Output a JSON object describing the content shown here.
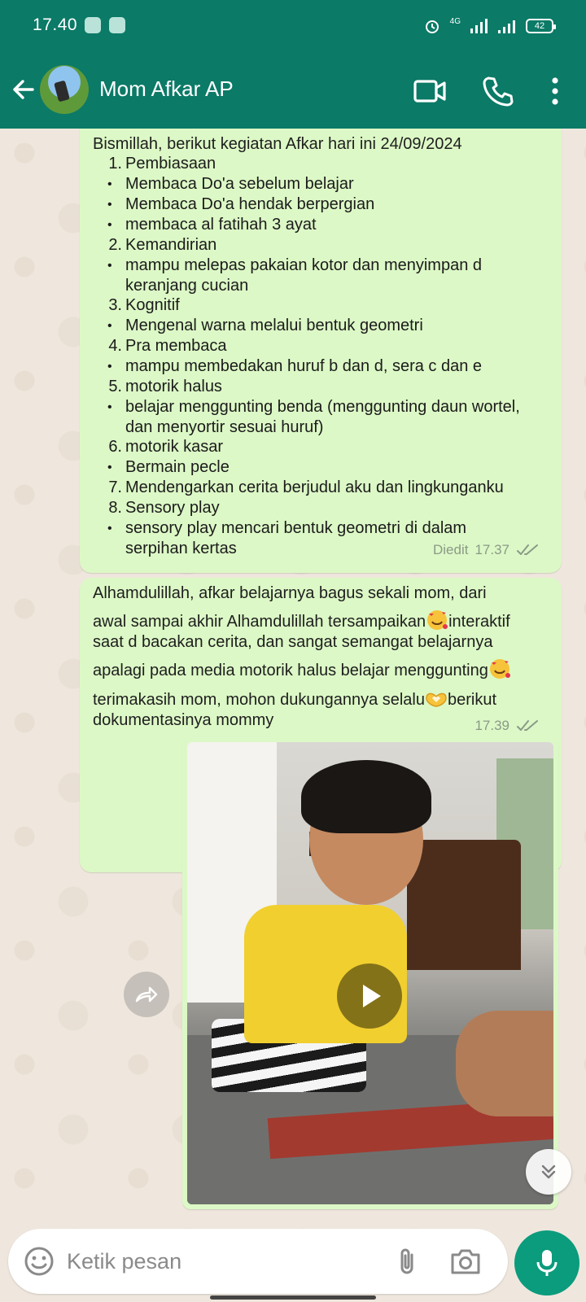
{
  "status_bar": {
    "time": "17.40",
    "network": "4G",
    "battery": "42"
  },
  "header": {
    "contact_name": "Mom Afkar AP"
  },
  "messages": [
    {
      "lines": [
        {
          "kind": "text",
          "text": "Bismillah, berikut kegiatan Afkar hari ini 24/09/2024"
        },
        {
          "kind": "num",
          "num": "1.",
          "text": "Pembiasaan"
        },
        {
          "kind": "bullet",
          "text": "Membaca Do'a sebelum belajar"
        },
        {
          "kind": "bullet",
          "text": "Membaca Do'a hendak berpergian"
        },
        {
          "kind": "bullet",
          "text": "membaca al fatihah 3 ayat"
        },
        {
          "kind": "num",
          "num": "2.",
          "text": "Kemandirian"
        },
        {
          "kind": "bullet",
          "text": "mampu melepas pakaian kotor dan menyimpan d"
        },
        {
          "kind": "cont",
          "text": "keranjang cucian"
        },
        {
          "kind": "num",
          "num": "3.",
          "text": "Kognitif"
        },
        {
          "kind": "bullet",
          "text": "Mengenal warna melalui bentuk geometri"
        },
        {
          "kind": "num",
          "num": "4.",
          "text": "Pra membaca"
        },
        {
          "kind": "bullet",
          "text": "mampu membedakan huruf b dan d, sera c dan e"
        },
        {
          "kind": "num",
          "num": "5.",
          "text": "motorik halus"
        },
        {
          "kind": "bullet",
          "text": "belajar menggunting benda (menggunting daun wortel,"
        },
        {
          "kind": "cont",
          "text": "dan menyortir sesuai huruf)"
        },
        {
          "kind": "num",
          "num": "6.",
          "text": "motorik kasar"
        },
        {
          "kind": "bullet",
          "text": "Bermain pecle"
        },
        {
          "kind": "num",
          "num": "7.",
          "text": "Mendengarkan cerita berjudul aku dan lingkunganku"
        },
        {
          "kind": "num",
          "num": "8.",
          "text": "Sensory play"
        },
        {
          "kind": "bullet",
          "text": "sensory play mencari bentuk geometri di dalam"
        },
        {
          "kind": "cont",
          "text": "serpihan kertas"
        }
      ],
      "edited_label": "Diedit",
      "time": "17.37"
    },
    {
      "lines": [
        "Alhamdulillah, afkar belajarnya bagus sekali mom, dari",
        "awal sampai akhir Alhamdulillah tersampaikan",
        "interaktif",
        "saat d bacakan cerita, dan sangat semangat belajarnya",
        "apalagi pada media motorik halus belajar menggunting",
        "terimakasih mom, mohon dukungannya selalu",
        "berikut",
        "dokumentasinya mommy"
      ],
      "time": "17.39"
    }
  ],
  "composer": {
    "placeholder": "Ketik pesan"
  },
  "colors": {
    "header": "#0b7a67",
    "outgoing_bubble": "#dcf8c6",
    "mic_button": "#0b9b7d",
    "wallpaper": "#efe7dd"
  },
  "icons": {
    "back": "back-arrow-icon",
    "video_call": "video-camera-icon",
    "voice_call": "phone-icon",
    "menu": "more-vert-icon",
    "play": "play-icon",
    "forward": "forward-icon",
    "scroll_down": "double-chevron-down-icon",
    "emoji": "emoji-icon",
    "attach": "paperclip-icon",
    "camera": "camera-icon",
    "mic": "microphone-icon"
  }
}
